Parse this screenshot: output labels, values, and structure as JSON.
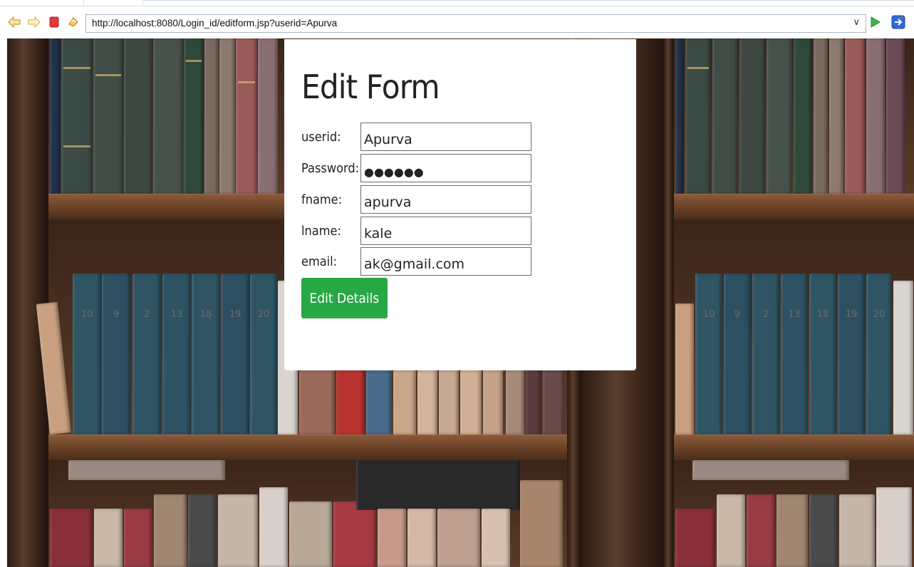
{
  "browser": {
    "url": "http://localhost:8080/Login_id/editform.jsp?userid=Apurva",
    "dropdown_glyph": "∨",
    "icons": [
      "back-arrow-icon",
      "forward-arrow-icon",
      "stop-icon",
      "refresh-icon",
      "go-icon",
      "navigate-icon"
    ],
    "colors": {
      "go": "#3cb54a",
      "navigate": "#2f6bd8",
      "stop": "#e03a3a",
      "refresh": "#f0a830"
    }
  },
  "form": {
    "title": "Edit Form",
    "fields": [
      {
        "label": "userid:",
        "value": "Apurva"
      },
      {
        "label": "Password:",
        "value": "●●●●●●"
      },
      {
        "label": "fname:",
        "value": "apurva"
      },
      {
        "label": "lname:",
        "value": "kale"
      },
      {
        "label": "email:",
        "value": "ak@gmail.com"
      }
    ],
    "submit_label": "Edit Details",
    "submit_color": "#28a745"
  },
  "background": {
    "spine_numbers": [
      "10",
      "9",
      "2",
      "13",
      "18",
      "19",
      "20"
    ]
  }
}
